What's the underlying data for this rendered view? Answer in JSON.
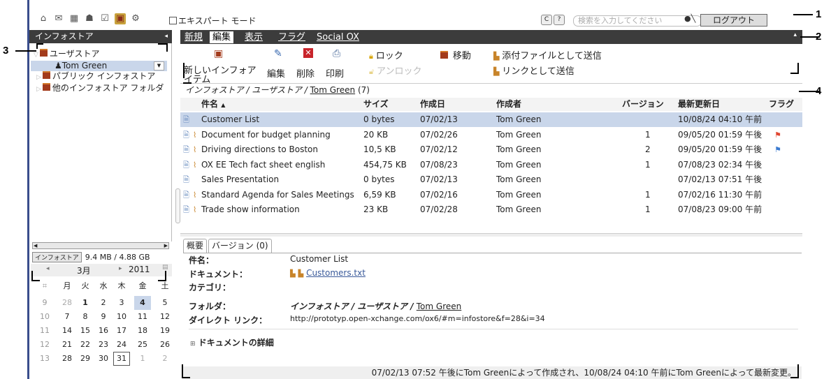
{
  "topbar": {
    "expert_mode_label": "エキスパート モード",
    "search_placeholder": "検索を入力してください",
    "logout_label": "ログアウト",
    "icons": [
      "home-icon",
      "mail-icon",
      "calendar-icon",
      "contacts-icon",
      "tasks-icon",
      "infostore-icon",
      "settings-icon"
    ]
  },
  "left": {
    "header": "インフォストア",
    "tree": {
      "user_store": "ユーザストア",
      "tom": "Tom Green",
      "public": "パブリック インフォストア",
      "other": "他のインフォストア フォルダ"
    },
    "quota_label": "インフォストア",
    "quota_value": "9.4 MB / 4.88 GB",
    "cal_month": "3月",
    "cal_year": "2011",
    "weekdays": [
      "月",
      "火",
      "水",
      "木",
      "金",
      "土"
    ],
    "weeks": [
      {
        "wk": "9",
        "days": [
          "28",
          "1",
          "2",
          "3",
          "4",
          "5"
        ]
      },
      {
        "wk": "10",
        "days": [
          "7",
          "8",
          "9",
          "10",
          "11",
          "12"
        ]
      },
      {
        "wk": "11",
        "days": [
          "14",
          "15",
          "16",
          "17",
          "18",
          "19"
        ]
      },
      {
        "wk": "12",
        "days": [
          "21",
          "22",
          "23",
          "24",
          "25",
          "26"
        ]
      },
      {
        "wk": "13",
        "days": [
          "28",
          "29",
          "30",
          "31",
          "1",
          "2"
        ]
      }
    ]
  },
  "main": {
    "tabs": [
      "新規",
      "編集",
      "表示",
      "フラグ",
      "Social OX"
    ],
    "toolbar": {
      "new_item": "新しいインフォアイテム",
      "edit": "編集",
      "delete": "削除",
      "print": "印刷",
      "lock": "ロック",
      "unlock": "アンロック",
      "move": "移動",
      "send_attachment": "添付ファイルとして送信",
      "send_link": "リンクとして送信"
    },
    "breadcrumb_path": "インフォストア / ユーザストア / ",
    "breadcrumb_folder": "Tom Green",
    "breadcrumb_count": "(7)",
    "columns": [
      "件名",
      "サイズ",
      "作成日",
      "作成者",
      "バージョン",
      "最新更新日",
      "フラグ"
    ],
    "rows": [
      {
        "name": "Customer List",
        "size": "0 bytes",
        "created": "07/02/13",
        "author": "Tom Green",
        "version": "",
        "modified": "10/08/24 04:10 午前",
        "clip": false,
        "flag": ""
      },
      {
        "name": "Document for budget planning",
        "size": "20 KB",
        "created": "07/02/26",
        "author": "Tom Green",
        "version": "1",
        "modified": "09/05/20 01:59 午後",
        "clip": true,
        "flag": "red"
      },
      {
        "name": "Driving directions to Boston",
        "size": "10,5 KB",
        "created": "07/02/12",
        "author": "Tom Green",
        "version": "2",
        "modified": "09/05/20 01:59 午後",
        "clip": true,
        "flag": "blue"
      },
      {
        "name": "OX EE Tech fact sheet english",
        "size": "454,75 KB",
        "created": "07/08/23",
        "author": "Tom Green",
        "version": "1",
        "modified": "07/08/23 02:34 午後",
        "clip": true,
        "flag": ""
      },
      {
        "name": "Sales Presentation",
        "size": "0 bytes",
        "created": "07/02/13",
        "author": "Tom Green",
        "version": "",
        "modified": "07/02/13 07:51 午後",
        "clip": false,
        "flag": ""
      },
      {
        "name": "Standard Agenda for Sales Meetings",
        "size": "6,59 KB",
        "created": "07/02/16",
        "author": "Tom Green",
        "version": "1",
        "modified": "07/02/16 11:30 午前",
        "clip": true,
        "flag": ""
      },
      {
        "name": "Trade show information",
        "size": "23 KB",
        "created": "07/02/28",
        "author": "Tom Green",
        "version": "1",
        "modified": "07/08/23 09:00 午前",
        "clip": true,
        "flag": ""
      }
    ]
  },
  "detail": {
    "tab_overview": "概要",
    "tab_versions": "バージョン (0)",
    "subject_label": "件名：",
    "subject": "Customer List",
    "document_label": "ドキュメント：",
    "document": "Customers.txt",
    "category_label": "カテゴリ：",
    "folder_label": "フォルダ：",
    "folder_path": "インフォストア / ユーザストア / ",
    "folder_name": "Tom Green",
    "direct_link_label": "ダイレクト リンク：",
    "direct_link": "http://prototyp.open-xchange.com/ox6/#m=infostore&f=28&i=34",
    "doc_details": "ドキュメントの詳細",
    "footer": "07/02/13 07:52 午後にTom Greenによって作成され、10/08/24 04:10 午前にTom Greenによって最新変更。"
  },
  "callouts": [
    "1",
    "2",
    "3",
    "4"
  ]
}
